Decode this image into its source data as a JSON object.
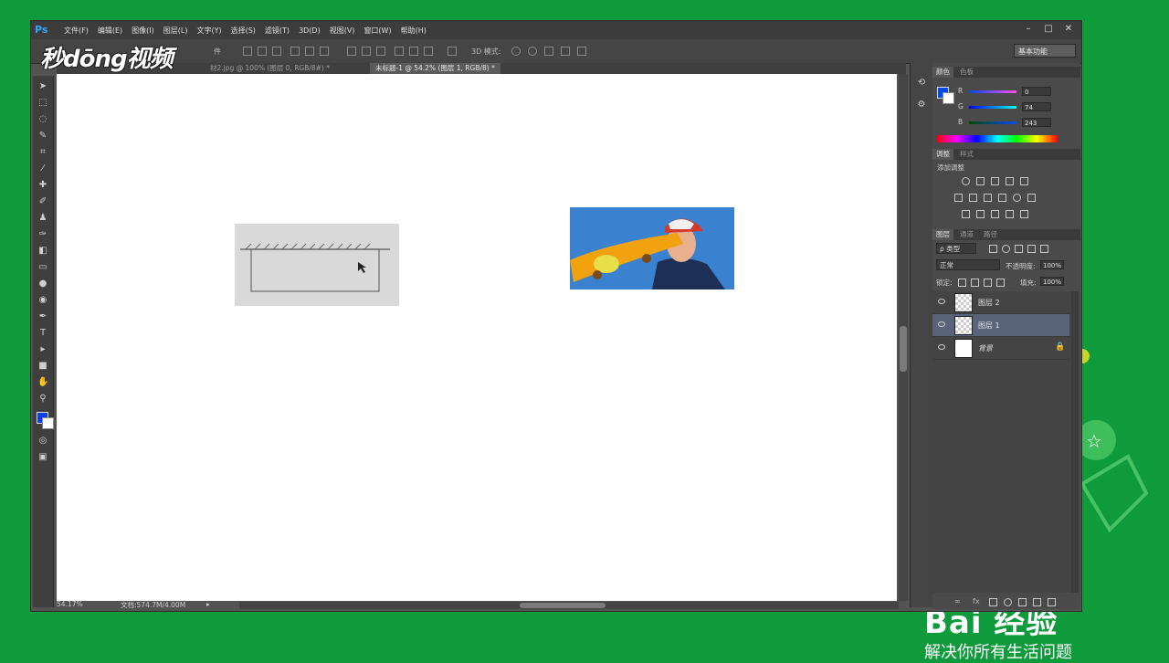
{
  "watermark": {
    "logo_text": "秒dōng视频",
    "brand": "Bai 经验",
    "slogan": "解决你所有生活问题"
  },
  "app": {
    "logo": "Ps",
    "menu": [
      "文件(F)",
      "编辑(E)",
      "图像(I)",
      "图层(L)",
      "文字(Y)",
      "选择(S)",
      "滤镜(T)",
      "3D(D)",
      "视图(V)",
      "窗口(W)",
      "帮助(H)"
    ],
    "window_controls": [
      "–",
      "□",
      "✕"
    ]
  },
  "options_bar": {
    "partial_label": "件",
    "mode_3d": "3D 模式:",
    "workspace": "基本功能"
  },
  "tabs": [
    {
      "label": "材2.jpg @ 100% (图层 0, RGB/8#) *",
      "active": false
    },
    {
      "label": "未标题-1 @ 54.2% (图层 1, RGB/8) *",
      "active": true
    }
  ],
  "status": {
    "zoom": "54.17%",
    "doc": "文档:574.7M/4.00M"
  },
  "color_panel": {
    "tabs": [
      "颜色",
      "色板"
    ],
    "channels": [
      {
        "name": "R",
        "value": "0"
      },
      {
        "name": "G",
        "value": "74"
      },
      {
        "name": "B",
        "value": "243"
      }
    ],
    "colors": {
      "foreground": "#004af3",
      "background": "#ffffff"
    }
  },
  "adjust_panel": {
    "tabs": [
      "调整",
      "样式"
    ],
    "heading": "添加调整"
  },
  "layers_panel": {
    "tabs": [
      "图层",
      "通道",
      "路径"
    ],
    "kind_filter": "ρ 类型",
    "blend_mode": "正常",
    "opacity_label": "不透明度:",
    "opacity_value": "100%",
    "lock_label": "锁定:",
    "fill_label": "填充:",
    "fill_value": "100%",
    "layers": [
      {
        "name": "图层 2",
        "selected": false,
        "thumb": "transparent"
      },
      {
        "name": "图层 1",
        "selected": true,
        "thumb": "transparent"
      },
      {
        "name": "背景",
        "selected": false,
        "thumb": "white",
        "locked": true
      }
    ],
    "footer_icons": [
      "link-icon",
      "fx-icon",
      "mask-icon",
      "adjustment-icon",
      "folder-icon",
      "new-layer-icon",
      "trash-icon"
    ]
  }
}
